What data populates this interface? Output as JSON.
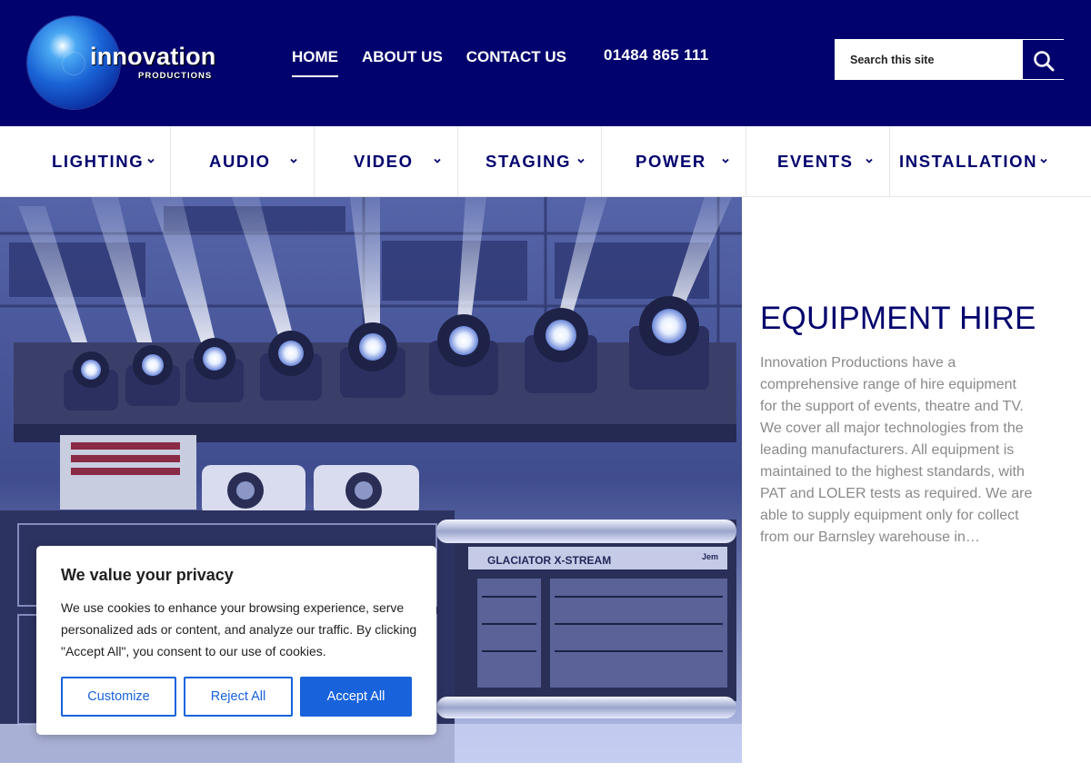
{
  "brand": {
    "name": "innovation",
    "tagline": "PRODUCTIONS"
  },
  "topnav": {
    "items": [
      {
        "label": "HOME",
        "active": true
      },
      {
        "label": "ABOUT US",
        "active": false
      },
      {
        "label": "CONTACT US",
        "active": false
      }
    ],
    "phone": "01484 865 111"
  },
  "search": {
    "placeholder": "Search this site",
    "icon": "search-icon"
  },
  "categories": [
    {
      "label": "LIGHTING"
    },
    {
      "label": "AUDIO"
    },
    {
      "label": "VIDEO"
    },
    {
      "label": "STAGING"
    },
    {
      "label": "POWER"
    },
    {
      "label": "EVENTS"
    },
    {
      "label": "INSTALLATION"
    }
  ],
  "hero": {
    "equipment_labels": [
      "GLACIATOR X-STREAM",
      "Jem"
    ]
  },
  "main": {
    "title": "EQUIPMENT HIRE",
    "body": "Innovation Productions have a comprehensive range of hire equipment for the support of events, theatre and TV. We cover all major technologies from the leading manufacturers. All equipment is maintained to the highest standards, with PAT and LOLER tests as required. We are able to supply equipment only for collect from our Barnsley warehouse in…"
  },
  "cookie_banner": {
    "title": "We value your privacy",
    "text": "We use cookies to enhance your browsing experience, serve personalized ads or content, and analyze our traffic. By clicking \"Accept All\", you consent to our use of cookies.",
    "buttons": {
      "customize": "Customize",
      "reject": "Reject All",
      "accept": "Accept All"
    }
  },
  "colors": {
    "brand_navy": "#02026e",
    "body_grey": "#8a8a8a",
    "cookie_blue": "#1863dc"
  }
}
